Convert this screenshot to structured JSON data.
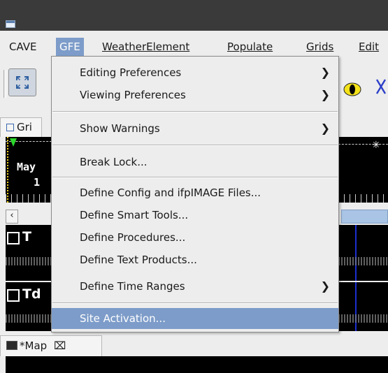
{
  "menubar": {
    "items": [
      "CAVE",
      "GFE",
      "WeatherElement",
      "Populate",
      "Grids",
      "Edit"
    ]
  },
  "editor": {
    "grid_tab_label": "Gri",
    "timeline_month": "May",
    "timeline_day": "1",
    "grid1_label": "T",
    "grid2_label": "Td"
  },
  "map_tab": {
    "label": "*Map",
    "close": "⌧"
  },
  "gfe_menu": {
    "editing_preferences": "Editing Preferences",
    "viewing_preferences": "Viewing Preferences",
    "show_warnings": "Show Warnings",
    "break_lock": "Break Lock...",
    "define_config": "Define Config and ifpIMAGE Files...",
    "define_smart_tools": "Define Smart Tools...",
    "define_procedures": "Define Procedures...",
    "define_text_products": "Define Text Products...",
    "define_time_ranges": "Define Time Ranges",
    "site_activation": "Site Activation..."
  },
  "colors": {
    "highlight": "#7d9cc9",
    "titlebar": "#3a3a3a"
  }
}
